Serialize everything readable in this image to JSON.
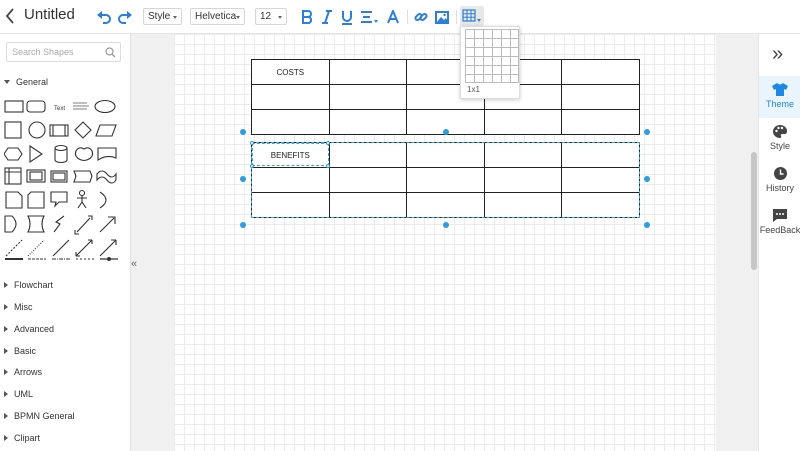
{
  "header": {
    "title": "Untitled",
    "style_select": "Style",
    "font_select": "Helvetica",
    "font_size_select": "12",
    "icons": [
      "back-icon",
      "undo-icon",
      "redo-icon",
      "bold-icon",
      "italic-icon",
      "underline-icon",
      "align-icon",
      "font-color-icon",
      "link-icon",
      "image-icon",
      "table-icon"
    ],
    "accent_color": "#2b7fd6"
  },
  "table_picker": {
    "size_label": "1x1"
  },
  "left_panel": {
    "search_placeholder": "Search Shapes",
    "general_label": "General",
    "text_shape_label": "Text",
    "categories": [
      "Flowchart",
      "Misc",
      "Advanced",
      "Basic",
      "Arrows",
      "UML",
      "BPMN General",
      "Clipart"
    ],
    "collapse_glyph": "«"
  },
  "canvas": {
    "table1": [
      [
        "COSTS",
        "",
        "",
        "",
        ""
      ],
      [
        "",
        "",
        "",
        "",
        ""
      ],
      [
        "",
        "",
        "",
        "",
        ""
      ]
    ],
    "table2": [
      [
        "BENEFITS",
        "",
        "",
        "",
        ""
      ],
      [
        "",
        "",
        "",
        "",
        ""
      ],
      [
        "",
        "",
        "",
        "",
        ""
      ]
    ],
    "selection_color": "#2d9de0"
  },
  "right_panel": {
    "expand_glyph": "»",
    "tabs": [
      {
        "label": "Theme",
        "icon": "shirt-icon",
        "active": true
      },
      {
        "label": "Style",
        "icon": "palette-icon",
        "active": false
      },
      {
        "label": "History",
        "icon": "clock-icon",
        "active": false
      },
      {
        "label": "FeedBack",
        "icon": "feedback-icon",
        "active": false
      }
    ]
  }
}
